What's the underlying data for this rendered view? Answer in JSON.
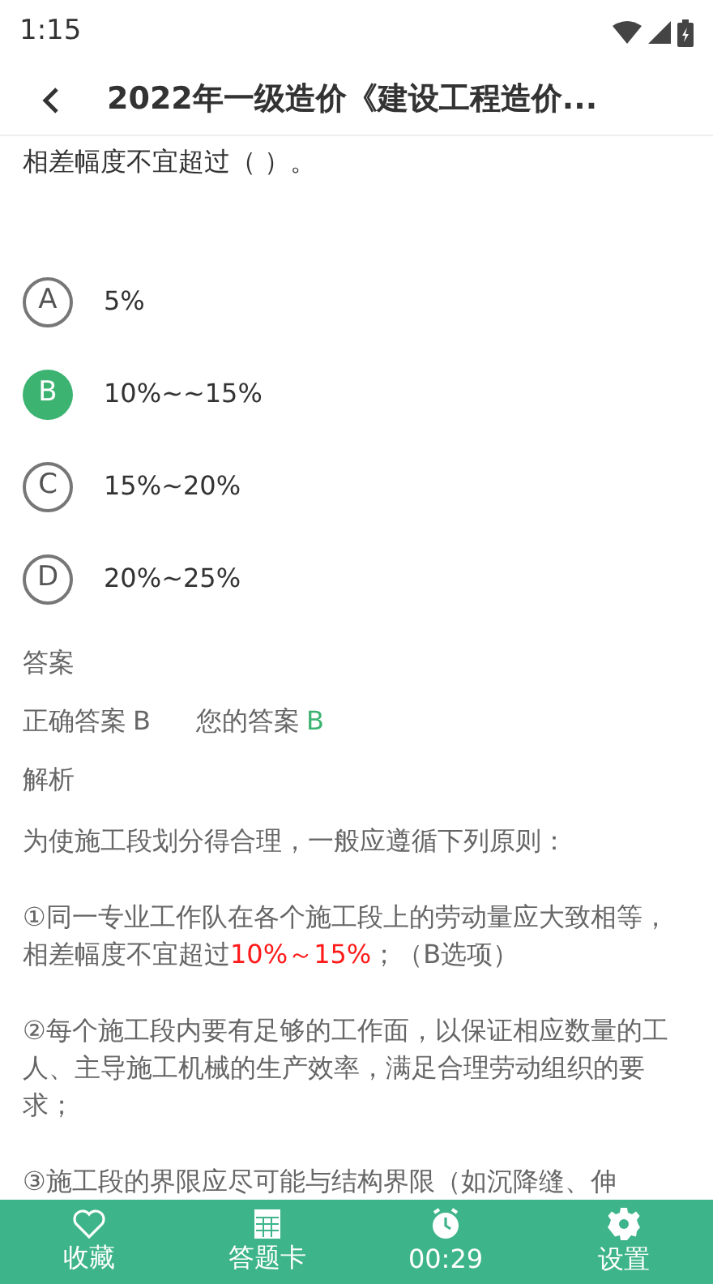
{
  "status_bar": {
    "time": "1:15"
  },
  "header": {
    "title": "2022年一级造价《建设工程造价..."
  },
  "question": {
    "text_tail": "相差幅度不宜超过（ ）。"
  },
  "options": [
    {
      "letter": "A",
      "text": "5%",
      "selected": false
    },
    {
      "letter": "B",
      "text": "10%~~15%",
      "selected": true
    },
    {
      "letter": "C",
      "text": "15%~20%",
      "selected": false
    },
    {
      "letter": "D",
      "text": "20%~25%",
      "selected": false
    }
  ],
  "answer": {
    "heading": "答案",
    "correct_label": "正确答案",
    "correct_value": "B",
    "yours_label": "您的答案",
    "yours_value": "B",
    "yours_correct": true
  },
  "analysis": {
    "heading": "解析",
    "paragraphs": [
      [
        {
          "text": "为使施工段划分得合理，一般应遵循下列原则：",
          "highlight": false
        }
      ],
      [
        {
          "text": "①同一专业工作队在各个施工段上的劳动量应大致相等，相差幅度不宜超过",
          "highlight": false
        },
        {
          "text": "10%～15%",
          "highlight": true
        },
        {
          "text": "；（B选项）",
          "highlight": false
        }
      ],
      [
        {
          "text": "②每个施工段内要有足够的工作面，以保证相应数量的工人、主导施工机械的生产效率，满足合理劳动组织的要求；",
          "highlight": false
        }
      ],
      [
        {
          "text": "③施工段的界限应尽可能与结构界限（如沉降缝、伸",
          "highlight": false
        }
      ]
    ]
  },
  "bottom_bar": [
    {
      "kind": "heart",
      "label": "收藏"
    },
    {
      "kind": "grid",
      "label": "答题卡"
    },
    {
      "kind": "clock",
      "label": "00:29"
    },
    {
      "kind": "gear",
      "label": "设置"
    }
  ]
}
